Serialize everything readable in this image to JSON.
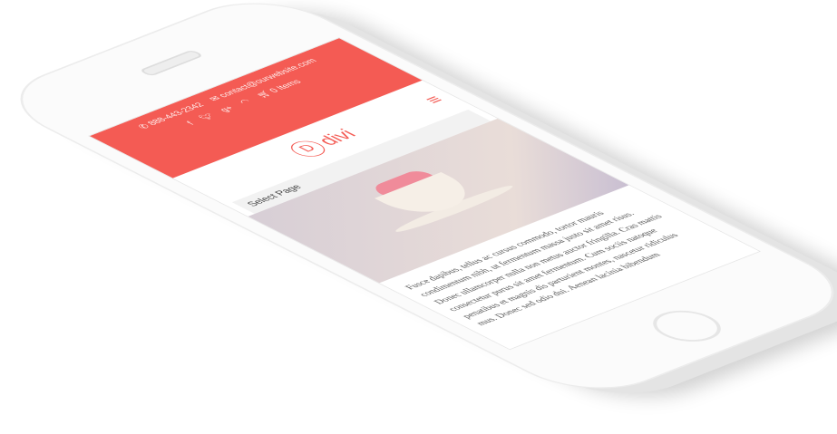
{
  "topbar": {
    "phone": "888-443-2342",
    "email": "contact@ourwebsite.com",
    "cart": "0 Items",
    "social": [
      "facebook-icon",
      "twitter-icon",
      "google-plus-icon",
      "rss-icon"
    ]
  },
  "header": {
    "logo_letter": "D",
    "logo_text": "divi",
    "menu_icon": "hamburger-icon"
  },
  "nav": {
    "select_label": "Select Page"
  },
  "body": {
    "paragraph": "Fusce dapibus, tellus ac cursus commodo, tortor mauris condimentum nibh, ut fermentum massa justo sit amet risus. Donec ullamcorper nulla non metus auctor fringilla. Cras mattis consectetur purus sit amet fermentum. Cum sociis natoque penatibus et magnis dis parturient montes, nascetur ridiculus mus. Donec sed odio dui. Aenean lacinia bibendum"
  },
  "colors": {
    "accent": "#f45b54"
  }
}
